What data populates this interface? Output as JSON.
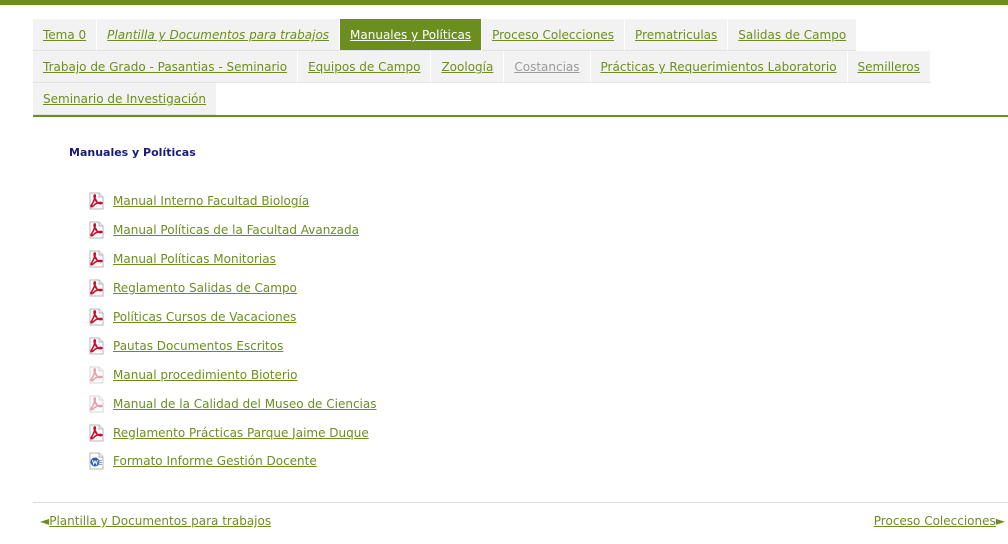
{
  "tabs": {
    "row1": [
      {
        "label": "Tema 0",
        "state": "normal"
      },
      {
        "label": "Plantilla y Documentos para trabajos",
        "state": "italic"
      },
      {
        "label": "Manuales y Políticas",
        "state": "active"
      },
      {
        "label": "Proceso Colecciones",
        "state": "normal"
      },
      {
        "label": "Prematriculas",
        "state": "normal"
      },
      {
        "label": "Salidas de Campo",
        "state": "normal"
      }
    ],
    "row2": [
      {
        "label": "Trabajo de Grado - Pasantias - Seminario",
        "state": "normal"
      },
      {
        "label": "Equipos de Campo",
        "state": "normal"
      },
      {
        "label": "Zoología",
        "state": "normal"
      },
      {
        "label": "Costancias",
        "state": "disabled"
      },
      {
        "label": "Prácticas y Requerimientos Laboratorio",
        "state": "normal"
      },
      {
        "label": "Semilleros",
        "state": "normal"
      }
    ],
    "row3": [
      {
        "label": "Seminario de Investigación",
        "state": "normal"
      }
    ]
  },
  "section": {
    "title": "Manuales y Políticas"
  },
  "documents": [
    {
      "label": "Manual Interno Facultad Biología",
      "icon": "pdf-icon"
    },
    {
      "label": "Manual Políticas de la Facultad Avanzada",
      "icon": "pdf-icon"
    },
    {
      "label": "Manual Políticas Monitorias",
      "icon": "pdf-icon"
    },
    {
      "label": "Reglamento Salidas de Campo",
      "icon": "pdf-icon"
    },
    {
      "label": "Políticas Cursos de Vacaciones",
      "icon": "pdf-icon"
    },
    {
      "label": "Pautas Documentos Escritos",
      "icon": "pdf-icon"
    },
    {
      "label": "Manual procedimiento Bioterio",
      "icon": "pdf-faded-icon"
    },
    {
      "label": "Manual de la Calidad del Museo de Ciencias",
      "icon": "pdf-faded-icon"
    },
    {
      "label": "Reglamento Prácticas Parque Jaime Duque",
      "icon": "pdf-icon"
    },
    {
      "label": "Formato Informe Gestión Docente",
      "icon": "word-icon"
    }
  ],
  "footer": {
    "prev_label": "Plantilla y Documentos para trabajos",
    "prev_arrow": "◄",
    "next_label": "Proceso Colecciones",
    "next_arrow": "►"
  },
  "colors": {
    "accent": "#6b8e1f",
    "title": "#1a1a7a",
    "tab_bg": "#f2f2f2",
    "pdf_red": "#c8102e",
    "word_blue": "#2a5caa"
  }
}
